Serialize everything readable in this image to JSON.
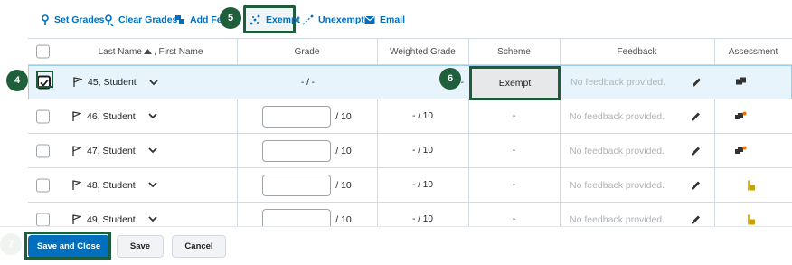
{
  "toolbar": {
    "set_grades": "Set Grades",
    "clear_grades": "Clear Grades",
    "add_feedback": "Add Feed",
    "exempt": "Exempt",
    "unexempt": "Unexempt",
    "email": "Email"
  },
  "callouts": {
    "c4": "4",
    "c5": "5",
    "c6": "6",
    "c7": "7"
  },
  "table": {
    "headers": {
      "name": "Last Name",
      "name_rest": ", First Name",
      "grade": "Grade",
      "weighted": "Weighted Grade",
      "scheme": "Scheme",
      "feedback": "Feedback",
      "assessment": "Assessment"
    },
    "rows": [
      {
        "name": "45, Student",
        "grade": "- / -",
        "weighted": "- / -",
        "scheme": "Exempt",
        "feedback": "No feedback provided.",
        "checked": true
      },
      {
        "name": "46, Student",
        "grade_suffix": "/ 10",
        "weighted": "- / 10",
        "scheme": "-",
        "feedback": "No feedback provided."
      },
      {
        "name": "47, Student",
        "grade_suffix": "/ 10",
        "weighted": "- / 10",
        "scheme": "-",
        "feedback": "No feedback provided."
      },
      {
        "name": "48, Student",
        "grade_suffix": "/ 10",
        "weighted": "- / 10",
        "scheme": "-",
        "feedback": "No feedback provided."
      },
      {
        "name": "49, Student",
        "grade_suffix": "/ 10",
        "weighted": "- / 10",
        "scheme": "-",
        "feedback": "No feedback provided."
      }
    ]
  },
  "footer": {
    "save_close": "Save and Close",
    "save": "Save",
    "cancel": "Cancel"
  },
  "colors": {
    "accent": "#006fbf",
    "callout": "#205f3b",
    "selected_row": "#e8f4fb"
  }
}
